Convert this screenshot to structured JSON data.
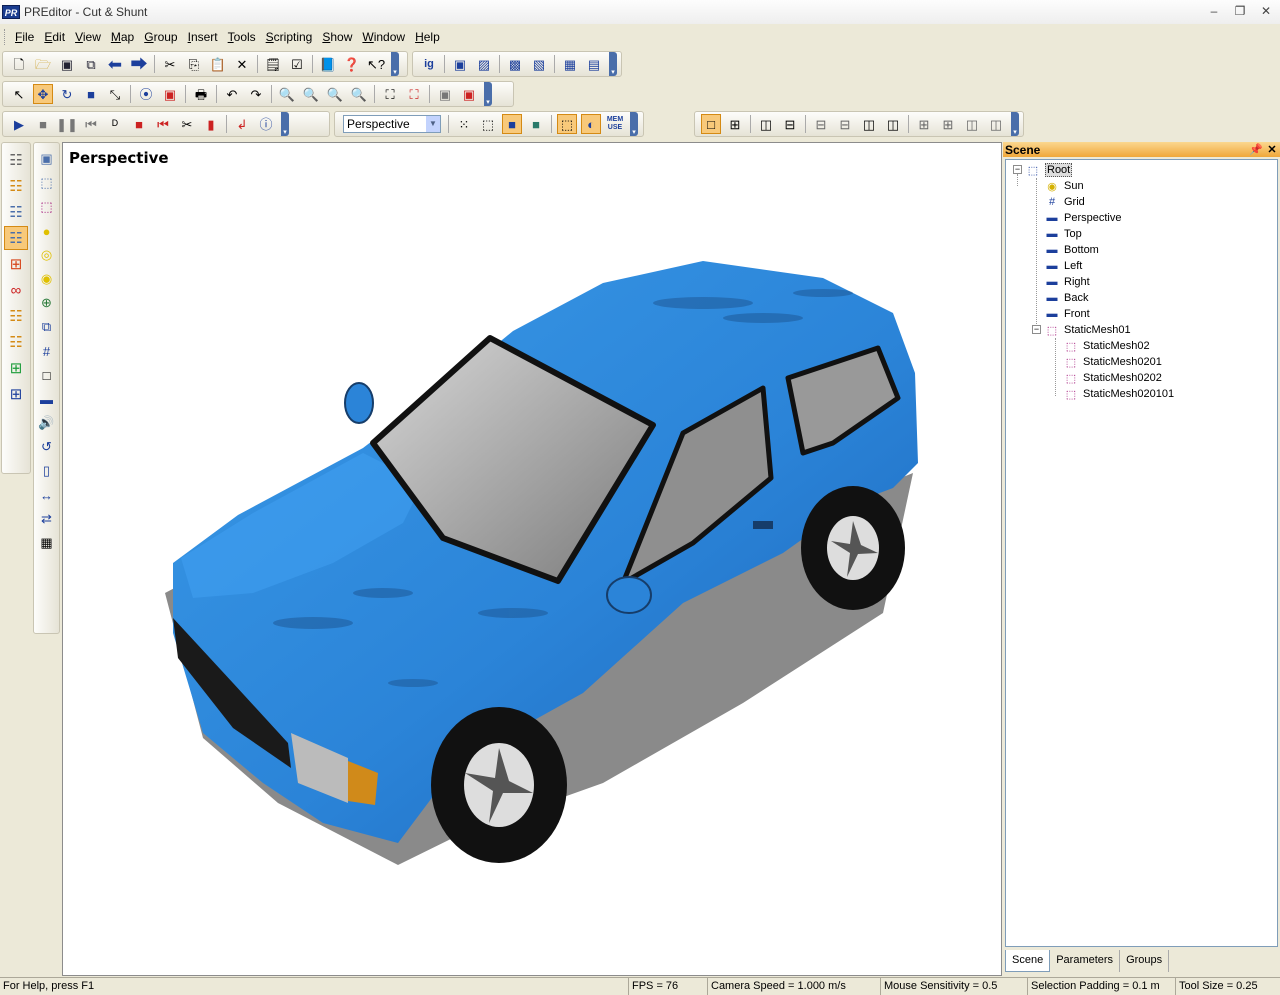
{
  "window": {
    "app_icon": "PR",
    "title": "PREditor - Cut & Shunt",
    "minimize_icon": "minimize-icon",
    "restore_icon": "restore-icon",
    "close_icon": "close-icon"
  },
  "menu": [
    {
      "first": "F",
      "rest": "ile"
    },
    {
      "first": "E",
      "rest": "dit"
    },
    {
      "first": "V",
      "rest": "iew"
    },
    {
      "first": "M",
      "rest": "ap"
    },
    {
      "first": "G",
      "rest": "roup"
    },
    {
      "first": "I",
      "rest": "nsert"
    },
    {
      "first": "T",
      "rest": "ools"
    },
    {
      "first": "S",
      "rest": "cripting"
    },
    {
      "first": "S",
      "rest": "how"
    },
    {
      "first": "W",
      "rest": "indow"
    },
    {
      "first": "H",
      "rest": "elp"
    }
  ],
  "toolbar": {
    "camera_select": "Perspective",
    "mem_use_line1": "MEM",
    "mem_use_line2": "USE"
  },
  "viewport": {
    "label": "Perspective"
  },
  "scene": {
    "title": "Scene",
    "pin_icon": "pin-icon",
    "close_icon": "close-icon",
    "tree": {
      "root": "Root",
      "sun": "Sun",
      "grid": "Grid",
      "perspective": "Perspective",
      "top": "Top",
      "bottom": "Bottom",
      "left": "Left",
      "right": "Right",
      "back": "Back",
      "front": "Front",
      "mesh01": "StaticMesh01",
      "mesh02": "StaticMesh02",
      "mesh0201": "StaticMesh0201",
      "mesh0202": "StaticMesh0202",
      "mesh020101": "StaticMesh020101"
    },
    "tabs": {
      "scene": "Scene",
      "parameters": "Parameters",
      "groups": "Groups"
    }
  },
  "status": {
    "help": "For Help, press F1",
    "fps": "FPS = 76",
    "camera_speed": "Camera Speed = 1.000 m/s",
    "mouse_sensitivity": "Mouse Sensitivity = 0.5",
    "selection_padding": "Selection Padding = 0.1 m",
    "tool_size": "Tool Size = 0.25"
  },
  "colors": {
    "accent": "#f0a73a",
    "car_body": "#2b84d8",
    "selection": "#f8c97a"
  }
}
